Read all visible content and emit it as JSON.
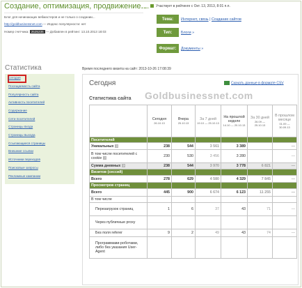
{
  "header": {
    "site_title": "Создание, оптимизация, продвижение...",
    "dots": "....",
    "rating_info": "Участвует в рейтинге с Окт. 13, 2013, 8:01 п.п.",
    "desc": "Блог для начинающих вебмастеров и не только о создании...",
    "url": "http://goldbusinessnet.com",
    "index_label": "— Индекс популярности: нет",
    "counter_label": "Номер счетчика:",
    "counter_number": "2525235",
    "added_label": "— Добавлен в рейтинг: 13.10.2013 18:03"
  },
  "meta": {
    "topic_label": "Тема:",
    "topic_value_1": "Интернет, связь",
    "topic_value_sep": " | ",
    "topic_value_2": "Создание сайтов",
    "type_label": "Тип:",
    "type_value": "Блоги",
    "type_arrow": "»",
    "format_label": "Формат:",
    "format_value": "Документы",
    "format_arrow": "»"
  },
  "sidebar": {
    "title": "Статистика",
    "items": [
      "Сегодня",
      "Посещаемость сайта",
      "Популярность сайта",
      "Активность посетителей",
      "Содержание",
      "Сети посетителей",
      "Страницы входа",
      "Страницы выхода",
      "Ссылающиеся страницы",
      "Внешние ссылки",
      "Источники переходов",
      "Поисковые запросы",
      "Рекламные кампании"
    ]
  },
  "main": {
    "last_visit": "Время последнего визита на сайт: 2013-10-26 17:08:39",
    "today_title": "Сегодня",
    "csv_label": "Скачать данные в формате CSV",
    "stat_title": "Статистика сайта",
    "watermark": "Goldbusinessnet.com"
  },
  "table": {
    "columns": [
      {
        "label": "Сегодня",
        "sub": "26.10.13"
      },
      {
        "label": "Вчера",
        "sub": "25.10.13"
      },
      {
        "label": "За 7 дней",
        "sub": "19.10 — 25.10.13"
      },
      {
        "label": "На прошлой неделе",
        "sub": "14.10 — 20.10.13"
      },
      {
        "label": "За 30 дней",
        "sub": "26.09 — 25.10.13"
      },
      {
        "label": "В прошлом месяце",
        "sub": "01.09 — 30.09.13"
      }
    ],
    "rows": [
      {
        "type": "section",
        "label": "Посетителей",
        "values": [
          "",
          "",
          "",
          "",
          "",
          ""
        ]
      },
      {
        "type": "bold",
        "label": "Уникальных",
        "help": "?",
        "values": [
          "238",
          "544",
          "3 561",
          "3 389",
          "",
          "—"
        ]
      },
      {
        "type": "normal",
        "label": "В том числе посетителей с cookie",
        "help": "?",
        "values": [
          "230",
          "530",
          "3 456",
          "3 280",
          "",
          "—"
        ]
      },
      {
        "type": "shaded-bold",
        "label": "Сумма дневных",
        "help": "?",
        "values": [
          "238",
          "544",
          "3 970",
          "3 778",
          "6 821",
          "—"
        ]
      },
      {
        "type": "section",
        "label": "Визитов (сессий)",
        "values": [
          "",
          "",
          "",
          "",
          "",
          ""
        ]
      },
      {
        "type": "bold",
        "label": "Всего",
        "values": [
          "278",
          "629",
          "4 580",
          "4 329",
          "7 845",
          "—"
        ]
      },
      {
        "type": "section",
        "label": "Просмотров страниц",
        "values": [
          "",
          "",
          "",
          "",
          "",
          ""
        ]
      },
      {
        "type": "bold",
        "label": "Всего",
        "values": [
          "445",
          "900",
          "6 674",
          "6 123",
          "11 255",
          "—"
        ]
      },
      {
        "type": "normal",
        "label": "В том числе",
        "values": [
          "",
          "",
          "",
          "",
          "",
          ""
        ]
      },
      {
        "type": "indent",
        "label": "Перезагрузок страниц",
        "values": [
          "1",
          "6",
          "37",
          "43",
          "71",
          "—"
        ]
      },
      {
        "type": "indent",
        "label": "Через публичные proxy",
        "values": [
          "",
          "",
          "",
          "",
          "",
          ""
        ]
      },
      {
        "type": "indent",
        "label": "Без поля referer",
        "values": [
          "9",
          "2",
          "49",
          "43",
          "74",
          "—"
        ]
      },
      {
        "type": "indent",
        "label": "Программами-роботами, либо без указания User-Agent",
        "values": [
          "",
          "",
          "",
          "",
          "",
          ""
        ]
      }
    ]
  },
  "colors": {
    "accent_green": "#6f9a3c",
    "section_green": "#6f8f3b",
    "link_blue": "#2a5db0",
    "active_outline": "#d21f1f"
  }
}
